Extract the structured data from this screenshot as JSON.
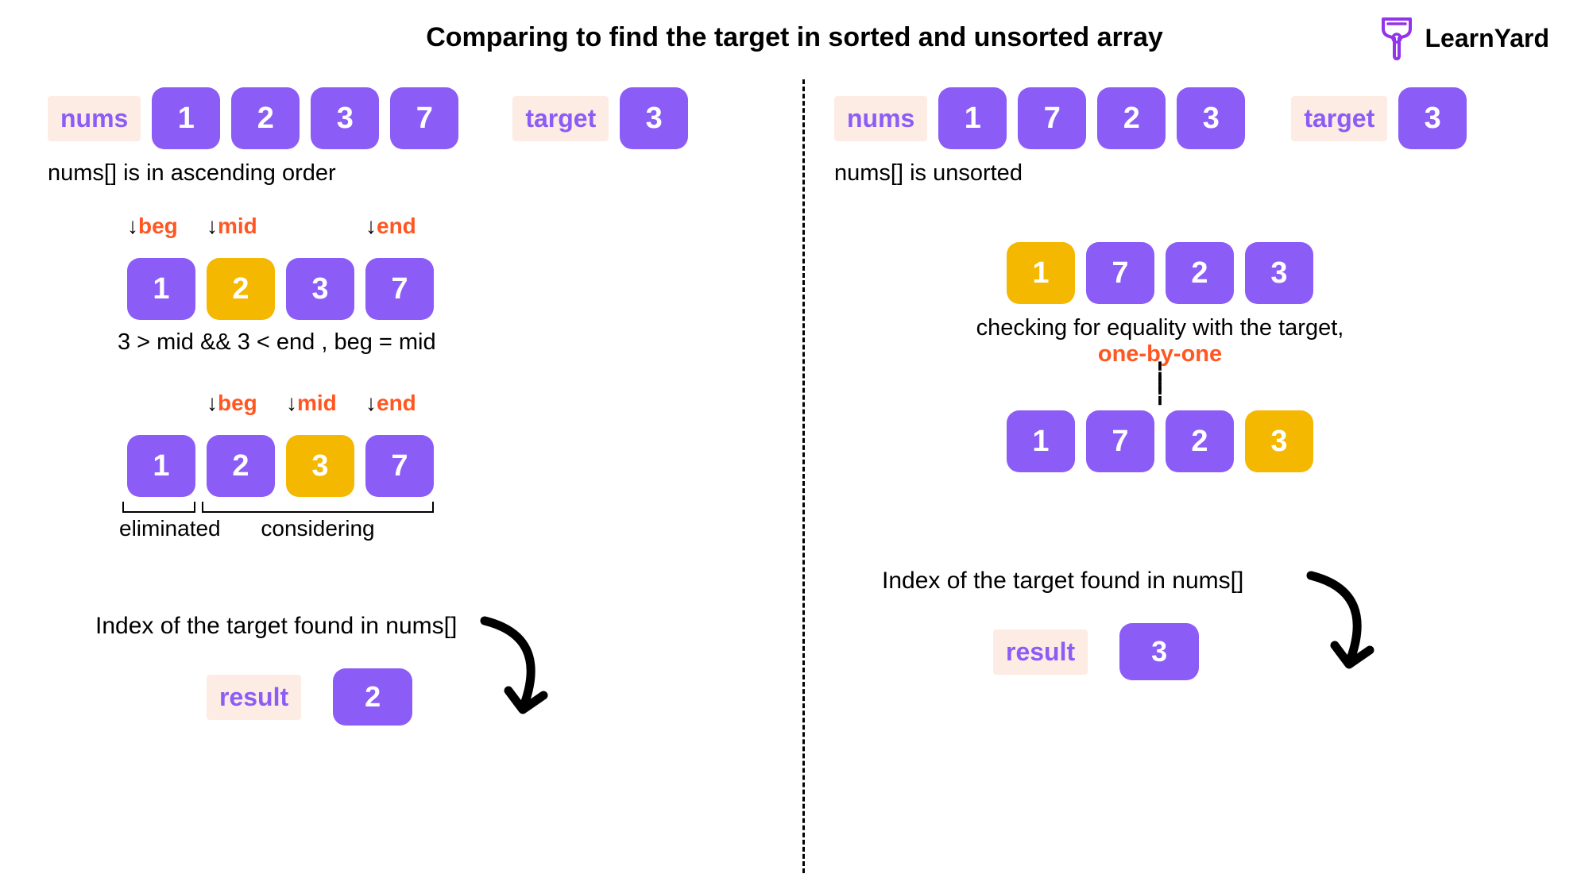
{
  "title": "Comparing to find the target in sorted and unsorted array",
  "logo_text": "LearnYard",
  "left": {
    "nums_label": "nums",
    "nums": [
      "1",
      "2",
      "3",
      "7"
    ],
    "target_label": "target",
    "target": "3",
    "subtitle": "nums[] is in ascending order",
    "step1": {
      "arr": [
        "1",
        "2",
        "3",
        "7"
      ],
      "highlight_index": 1,
      "pointers": [
        {
          "pos": 0,
          "label": "beg"
        },
        {
          "pos": 1,
          "label": "mid"
        },
        {
          "pos": 3,
          "label": "end"
        }
      ],
      "caption": "3 > mid && 3 < end  , beg = mid"
    },
    "step2": {
      "arr": [
        "1",
        "2",
        "3",
        "7"
      ],
      "highlight_index": 2,
      "pointers": [
        {
          "pos": 1,
          "label": "beg"
        },
        {
          "pos": 2,
          "label": "mid"
        },
        {
          "pos": 3,
          "label": "end"
        }
      ],
      "brackets": [
        {
          "span": 1,
          "label": "eliminated"
        },
        {
          "span": 3,
          "label": "considering"
        }
      ]
    },
    "result_head": "Index of the target found in nums[]",
    "result_label": "result",
    "result_value": "2"
  },
  "right": {
    "nums_label": "nums",
    "nums": [
      "1",
      "7",
      "2",
      "3"
    ],
    "target_label": "target",
    "target": "3",
    "subtitle": "nums[] is unsorted",
    "linear": {
      "arr_top": [
        "1",
        "7",
        "2",
        "3"
      ],
      "top_highlight": 0,
      "caption_line1": "checking for equality with the target,",
      "caption_line2": "one-by-one",
      "arr_bottom": [
        "1",
        "7",
        "2",
        "3"
      ],
      "bottom_highlight": 3
    },
    "result_head": "Index of the target found in nums[]",
    "result_label": "result",
    "result_value": "3"
  }
}
